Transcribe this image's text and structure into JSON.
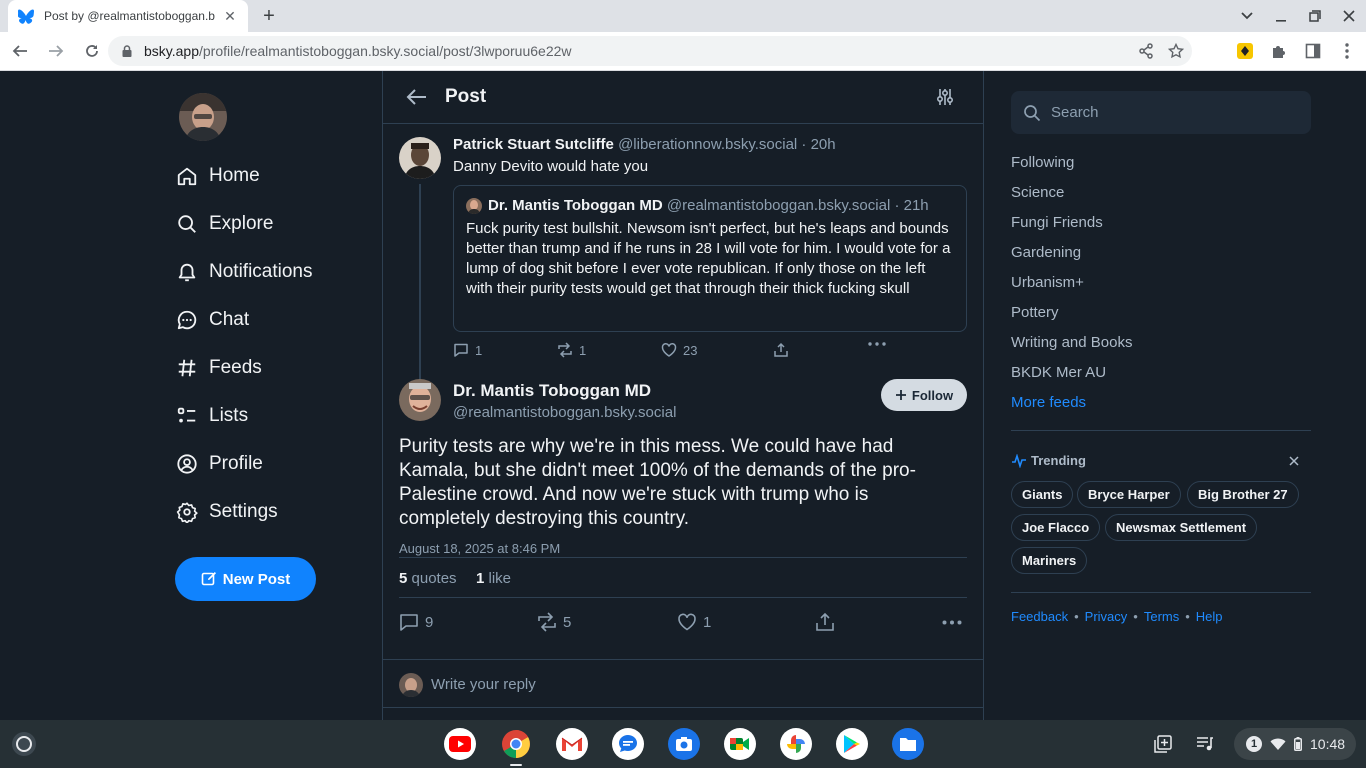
{
  "browser": {
    "tab_title": "Post by @realmantistoboggan.b",
    "url_host": "bsky.app",
    "url_path": "/profile/realmantistoboggan.bsky.social/post/3lwporuu6e22w"
  },
  "nav": {
    "items": [
      {
        "label": "Home",
        "icon": "home-icon"
      },
      {
        "label": "Explore",
        "icon": "search-icon"
      },
      {
        "label": "Notifications",
        "icon": "bell-icon"
      },
      {
        "label": "Chat",
        "icon": "chat-icon"
      },
      {
        "label": "Feeds",
        "icon": "hash-icon"
      },
      {
        "label": "Lists",
        "icon": "list-icon"
      },
      {
        "label": "Profile",
        "icon": "user-circle-icon"
      },
      {
        "label": "Settings",
        "icon": "gear-icon"
      }
    ],
    "new_post": "New Post"
  },
  "header": {
    "title": "Post"
  },
  "parent_post": {
    "author_name": "Patrick Stuart Sutcliffe",
    "author_handle": "@liberationnow.bsky.social · 20h",
    "text": "Danny Devito would hate you",
    "quote": {
      "author_name": "Dr. Mantis Toboggan MD",
      "author_handle": "@realmantistoboggan.bsky.social · 21h",
      "text": "Fuck purity test bullshit. Newsom isn't perfect, but he's leaps and bounds better than trump and if he runs in 28 I will vote for him. I would vote for a lump of dog shit before I ever vote republican. If only those on the left with their purity tests would get that through their thick fucking skull"
    },
    "replies": "1",
    "reposts": "1",
    "likes": "23"
  },
  "main_post": {
    "author_name": "Dr. Mantis Toboggan MD",
    "author_handle": "@realmantistoboggan.bsky.social",
    "follow_label": "Follow",
    "text": "Purity tests are why we're in this mess. We could have had Kamala, but she didn't meet 100% of the demands of the pro-Palestine crowd. And now we're stuck with trump who is completely destroying this country.",
    "date": "August 18, 2025 at 8:46 PM",
    "quotes_count": "5",
    "quotes_label": "quotes",
    "likes_count": "1",
    "likes_label": "like",
    "replies": "9",
    "reposts": "5",
    "likes": "1"
  },
  "reply": {
    "placeholder": "Write your reply"
  },
  "right": {
    "search_placeholder": "Search",
    "feeds": [
      "Following",
      "Science",
      "Fungi Friends",
      "Gardening",
      "Urbanism+",
      "Pottery",
      "Writing and Books",
      "BKDK Mer AU"
    ],
    "more_feeds": "More feeds",
    "trending_title": "Trending",
    "trending": [
      "Giants",
      "Bryce Harper",
      "Big Brother 27",
      "Joe Flacco",
      "Newsmax Settlement",
      "Mariners"
    ],
    "footer": [
      "Feedback",
      "Privacy",
      "Terms",
      "Help"
    ]
  },
  "shelf": {
    "time": "10:48",
    "notification_count": "1",
    "apps": [
      "youtube-icon",
      "chrome-icon",
      "gmail-icon",
      "messages-icon",
      "camera-icon",
      "meet-icon",
      "photos-icon",
      "play-store-icon",
      "files-icon"
    ]
  },
  "colors": {
    "background": "#161e27",
    "accent": "#1083fe",
    "link": "#208bfe",
    "border": "#2e4052"
  }
}
